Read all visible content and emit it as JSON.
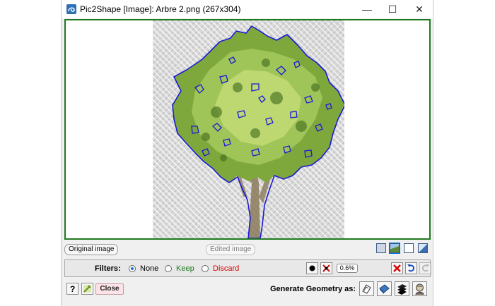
{
  "window": {
    "title": "Pic2Shape [Image]: Arbre 2.png (267x304)",
    "icons": {
      "app": "pic2shape-app-icon",
      "minimize": "minimize-icon",
      "maximize": "maximize-icon",
      "close": "close-icon"
    },
    "buttons": {
      "minimize": "—",
      "maximize": "☐",
      "close": "✕"
    }
  },
  "canvas": {
    "border_color": "#1f7a1f",
    "contour_color": "#1a1ad6",
    "foliage_colors": [
      "#6f9e2e",
      "#9dc257",
      "#c7de7a",
      "#3f6a1c"
    ],
    "trunk_color": "#8a7a5a"
  },
  "view_toggle": {
    "original_label": "Original image",
    "edited_label": "Edited image"
  },
  "display_modes": [
    "image-only-mode-icon",
    "image-with-contour-mode-icon",
    "contour-only-mode-icon",
    "preview-mode-icon"
  ],
  "filters": {
    "label": "Filters:",
    "options": [
      {
        "label": "None",
        "color": "#000000",
        "checked": true
      },
      {
        "label": "Keep",
        "color": "#1f7a1f",
        "checked": false
      },
      {
        "label": "Discard",
        "color": "#d40000",
        "checked": false
      }
    ],
    "tolerance": "0.6%",
    "icons": {
      "point": "point-size-icon",
      "reset": "reset-zones-icon",
      "clear": "clear-red-x-icon",
      "undo": "undo-icon",
      "redo": "redo-icon"
    }
  },
  "footer": {
    "help_icon": "help-question-icon",
    "tools_icon": "tools-wrench-icon",
    "close_label": "Close",
    "generate_label": "Generate Geometry as:",
    "geometry_icons": [
      "generate-face-icon",
      "generate-surface-icon",
      "generate-solid-icon",
      "generate-component-icon"
    ]
  }
}
